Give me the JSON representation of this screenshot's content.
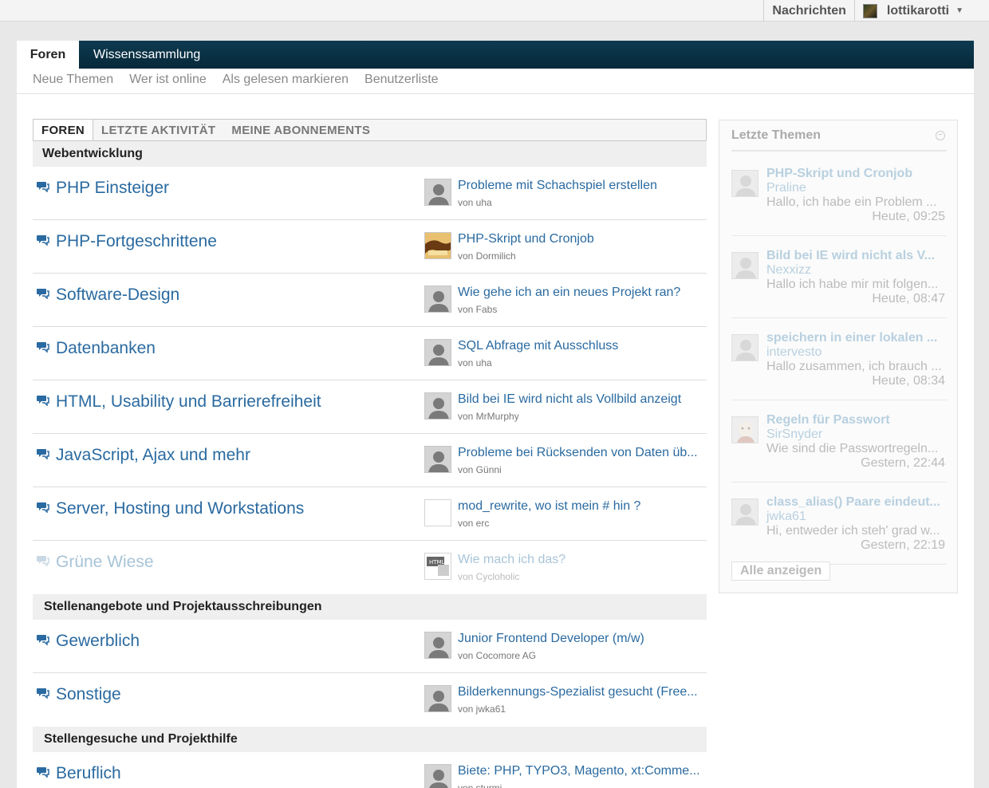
{
  "topbar": {
    "messages": "Nachrichten",
    "username": "lottikarotti"
  },
  "mainnav": {
    "tabs": [
      {
        "label": "Foren"
      },
      {
        "label": "Wissenssammlung"
      }
    ]
  },
  "subnav": {
    "items": [
      {
        "label": "Neue Themen"
      },
      {
        "label": "Wer ist online"
      },
      {
        "label": "Als gelesen markieren"
      },
      {
        "label": "Benutzerliste"
      }
    ]
  },
  "content_tabs": [
    {
      "label": "FOREN"
    },
    {
      "label": "LETZTE AKTIVITÄT"
    },
    {
      "label": "MEINE ABONNEMENTS"
    }
  ],
  "categories": [
    {
      "name": "Webentwicklung",
      "forums": [
        {
          "name": "PHP Einsteiger",
          "last_title": "Probleme mit Schachspiel erstellen",
          "last_by": "von uha"
        },
        {
          "name": "PHP-Fortgeschrittene",
          "last_title": "PHP-Skript und Cronjob",
          "last_by": "von Dormilich"
        },
        {
          "name": "Software-Design",
          "last_title": "Wie gehe ich an ein neues Projekt ran?",
          "last_by": "von Fabs"
        },
        {
          "name": "Datenbanken",
          "last_title": "SQL Abfrage mit Ausschluss",
          "last_by": "von uha"
        },
        {
          "name": "HTML, Usability und Barrierefreiheit",
          "last_title": "Bild bei IE wird nicht als Vollbild anzeigt",
          "last_by": "von MrMurphy"
        },
        {
          "name": "JavaScript, Ajax und mehr",
          "last_title": "Probleme bei Rücksenden von Daten üb...",
          "last_by": "von Günni"
        },
        {
          "name": "Server, Hosting und Workstations",
          "last_title": "mod_rewrite, wo ist mein # hin ?",
          "last_by": "von erc"
        },
        {
          "name": "Grüne Wiese",
          "last_title": "Wie mach ich das?",
          "last_by": "von Cycloholic"
        }
      ]
    },
    {
      "name": "Stellenangebote und Projektausschreibungen",
      "forums": [
        {
          "name": "Gewerblich",
          "last_title": "Junior Frontend Developer (m/w)",
          "last_by": "von Cocomore AG"
        },
        {
          "name": "Sonstige",
          "last_title": "Bilderkennungs-Spezialist gesucht (Free...",
          "last_by": "von jwka61"
        }
      ]
    },
    {
      "name": "Stellengesuche und Projekthilfe",
      "forums": [
        {
          "name": "Beruflich",
          "last_title": "Biete: PHP, TYPO3, Magento, xt:Comme...",
          "last_by": "von sturmi"
        }
      ]
    }
  ],
  "sidebar": {
    "title": "Letzte Themen",
    "entries": [
      {
        "title": "PHP-Skript und Cronjob",
        "author": "Praline",
        "excerpt": "Hallo, ich habe ein Problem ...",
        "time": "Heute, 09:25"
      },
      {
        "title": "Bild bei IE wird nicht als V...",
        "author": "Nexxizz",
        "excerpt": "Hallo ich habe mir mit folgen...",
        "time": "Heute, 08:47"
      },
      {
        "title": "speichern in einer lokalen ...",
        "author": "intervesto",
        "excerpt": "Hallo zusammen, ich brauch ...",
        "time": "Heute, 08:34"
      },
      {
        "title": "Regeln für Passwort",
        "author": "SirSnyder",
        "excerpt": "Wie sind die Passwortregeln...",
        "time": "Gestern, 22:44"
      },
      {
        "title": "class_alias() Paare eindeut...",
        "author": "jwka61",
        "excerpt": "Hi, entweder ich steh' grad w...",
        "time": "Gestern, 22:19"
      }
    ],
    "show_all": "Alle anzeigen"
  },
  "colors": {
    "link": "#2a6aa0",
    "nav_bg": "#06293a",
    "muted_link": "#a8c4d8"
  }
}
